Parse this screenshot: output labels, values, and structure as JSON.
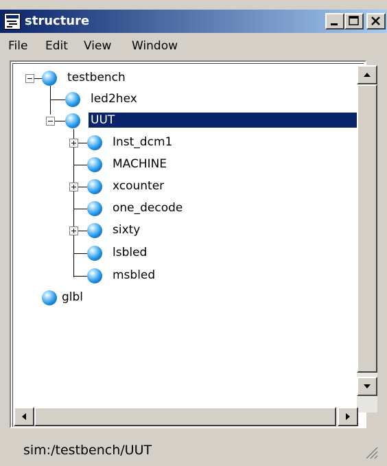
{
  "window": {
    "title": "structure",
    "accent": "#0a246a"
  },
  "menu": [
    "File",
    "Edit",
    "View",
    "Window"
  ],
  "tree": {
    "nodes": [
      {
        "label": "testbench",
        "depth": 0,
        "expander": "minus"
      },
      {
        "label": "led2hex",
        "depth": 1
      },
      {
        "label": "UUT",
        "depth": 1,
        "expander": "minus",
        "selected": true
      },
      {
        "label": "Inst_dcm1",
        "depth": 2,
        "expander": "plus"
      },
      {
        "label": "MACHINE",
        "depth": 2
      },
      {
        "label": "xcounter",
        "depth": 2,
        "expander": "plus"
      },
      {
        "label": "one_decode",
        "depth": 2
      },
      {
        "label": "sixty",
        "depth": 2,
        "expander": "plus"
      },
      {
        "label": "lsbled",
        "depth": 2
      },
      {
        "label": "msbled",
        "depth": 2
      },
      {
        "label": "glbl",
        "depth": 0
      }
    ]
  },
  "status": {
    "text": "sim:/testbench/UUT"
  },
  "icons": {
    "node": "blue-sphere-icon",
    "expand": "plus-box-icon",
    "collapse": "minus-box-icon"
  }
}
